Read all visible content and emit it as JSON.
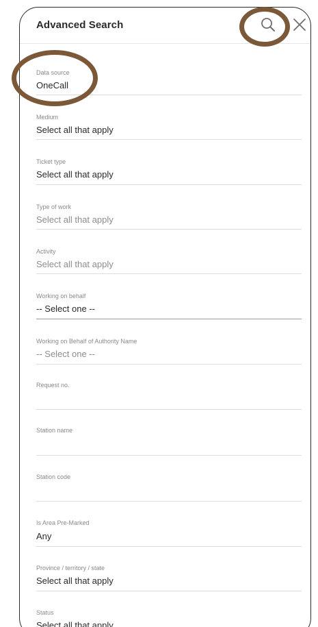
{
  "header": {
    "title": "Advanced Search",
    "search_icon": "search-icon",
    "close_icon": "close-icon"
  },
  "fields": [
    {
      "label": "Data source",
      "value": "OneCall",
      "muted": false
    },
    {
      "label": "Medium",
      "value": "Select all that apply",
      "muted": false
    },
    {
      "label": "Ticket type",
      "value": "Select all that apply",
      "muted": false
    },
    {
      "label": "Type of work",
      "value": "Select all that apply",
      "muted": true
    },
    {
      "label": "Activity",
      "value": "Select all that apply",
      "muted": true
    },
    {
      "label": "Working on behalf",
      "value": "-- Select one --",
      "muted": false
    },
    {
      "label": "Working on Behalf of Authority Name",
      "value": "-- Select one --",
      "muted": true
    },
    {
      "label": "Request no.",
      "value": "",
      "muted": false
    },
    {
      "label": "Station name",
      "value": "",
      "muted": false
    },
    {
      "label": "Station code",
      "value": "",
      "muted": false
    },
    {
      "label": "Is Area Pre-Marked",
      "value": "Any",
      "muted": false
    },
    {
      "label": "Province / territory / state",
      "value": "Select all that apply",
      "muted": false
    },
    {
      "label": "Status",
      "value": "Select all that apply",
      "muted": false
    }
  ],
  "colors": {
    "annotation_ring": "#7a5838",
    "text": "#2a2a2a",
    "label": "#8a8a8a",
    "muted_value": "#8d8d8d"
  }
}
